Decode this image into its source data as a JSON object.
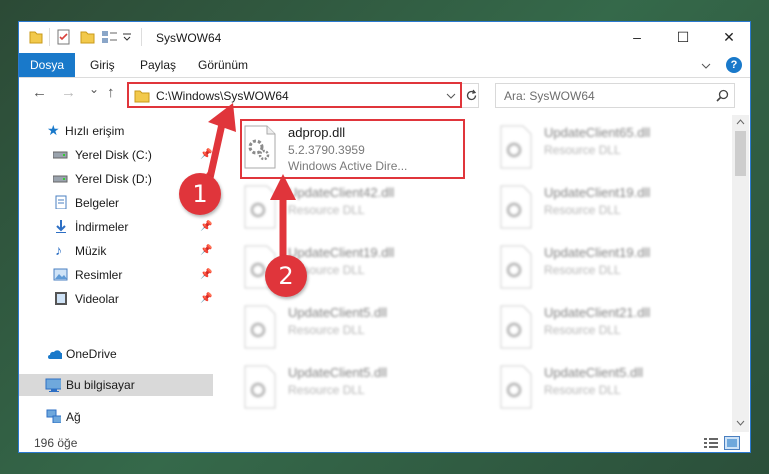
{
  "window": {
    "title": "SysWOW64",
    "controls": {
      "minimize": "–",
      "maximize": "☐",
      "close": "✕"
    }
  },
  "ribbon": {
    "tabs": [
      "Dosya",
      "Giriş",
      "Paylaş",
      "Görünüm"
    ],
    "help": "?"
  },
  "nav": {
    "back": "←",
    "forward": "→",
    "recent": "⌄",
    "up": "↑",
    "address": "C:\\Windows\\SysWOW64",
    "search_placeholder": "Ara: SysWOW64"
  },
  "sidebar": {
    "items": [
      {
        "label": "Hızlı erişim",
        "icon": "star-icon"
      },
      {
        "label": "Yerel Disk (C:)",
        "icon": "drive-icon",
        "pinned": true
      },
      {
        "label": "Yerel Disk (D:)",
        "icon": "drive-icon",
        "pinned": true
      },
      {
        "label": "Belgeler",
        "icon": "documents-icon",
        "pinned": true
      },
      {
        "label": "İndirmeler",
        "icon": "download-icon",
        "pinned": true
      },
      {
        "label": "Müzik",
        "icon": "music-icon",
        "pinned": true
      },
      {
        "label": "Resimler",
        "icon": "pictures-icon",
        "pinned": true
      },
      {
        "label": "Videolar",
        "icon": "videos-icon",
        "pinned": true
      },
      {
        "label": "OneDrive",
        "icon": "onedrive-icon"
      },
      {
        "label": "Bu bilgisayar",
        "icon": "computer-icon",
        "selected": true
      },
      {
        "label": "Ağ",
        "icon": "network-icon"
      }
    ]
  },
  "files": {
    "main": {
      "name": "adprop.dll",
      "version": "5.2.3790.3959",
      "desc": "Windows Active Dire..."
    },
    "blurred": [
      {
        "name": "UpdateClient65.dll",
        "desc": "Resource DLL"
      },
      {
        "name": "UpdateClient42.dll",
        "desc": "Resource DLL"
      },
      {
        "name": "UpdateClient19.dll",
        "desc": "Resource DLL"
      },
      {
        "name": "UpdateClient19.dll",
        "desc": "Resource DLL"
      },
      {
        "name": "UpdateClient19.dll",
        "desc": "Resource DLL"
      },
      {
        "name": "UpdateClient5.dll",
        "desc": "Resource DLL"
      },
      {
        "name": "UpdateClient21.dll",
        "desc": "Resource DLL"
      },
      {
        "name": "UpdateClient5.dll",
        "desc": "Resource DLL"
      },
      {
        "name": "UpdateClient5.dll",
        "desc": "Resource DLL"
      }
    ]
  },
  "status": {
    "count": "196 öğe"
  },
  "callouts": {
    "one": "1",
    "two": "2"
  },
  "colors": {
    "accent": "#1979ca",
    "highlight": "#e0353b"
  }
}
